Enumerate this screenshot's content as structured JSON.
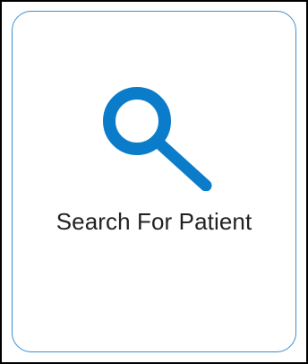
{
  "card": {
    "label": "Search For Patient",
    "icon": "search-icon",
    "border_color": "#3b8fd2",
    "icon_color": "#0a7cc9",
    "text_color": "#222222"
  }
}
